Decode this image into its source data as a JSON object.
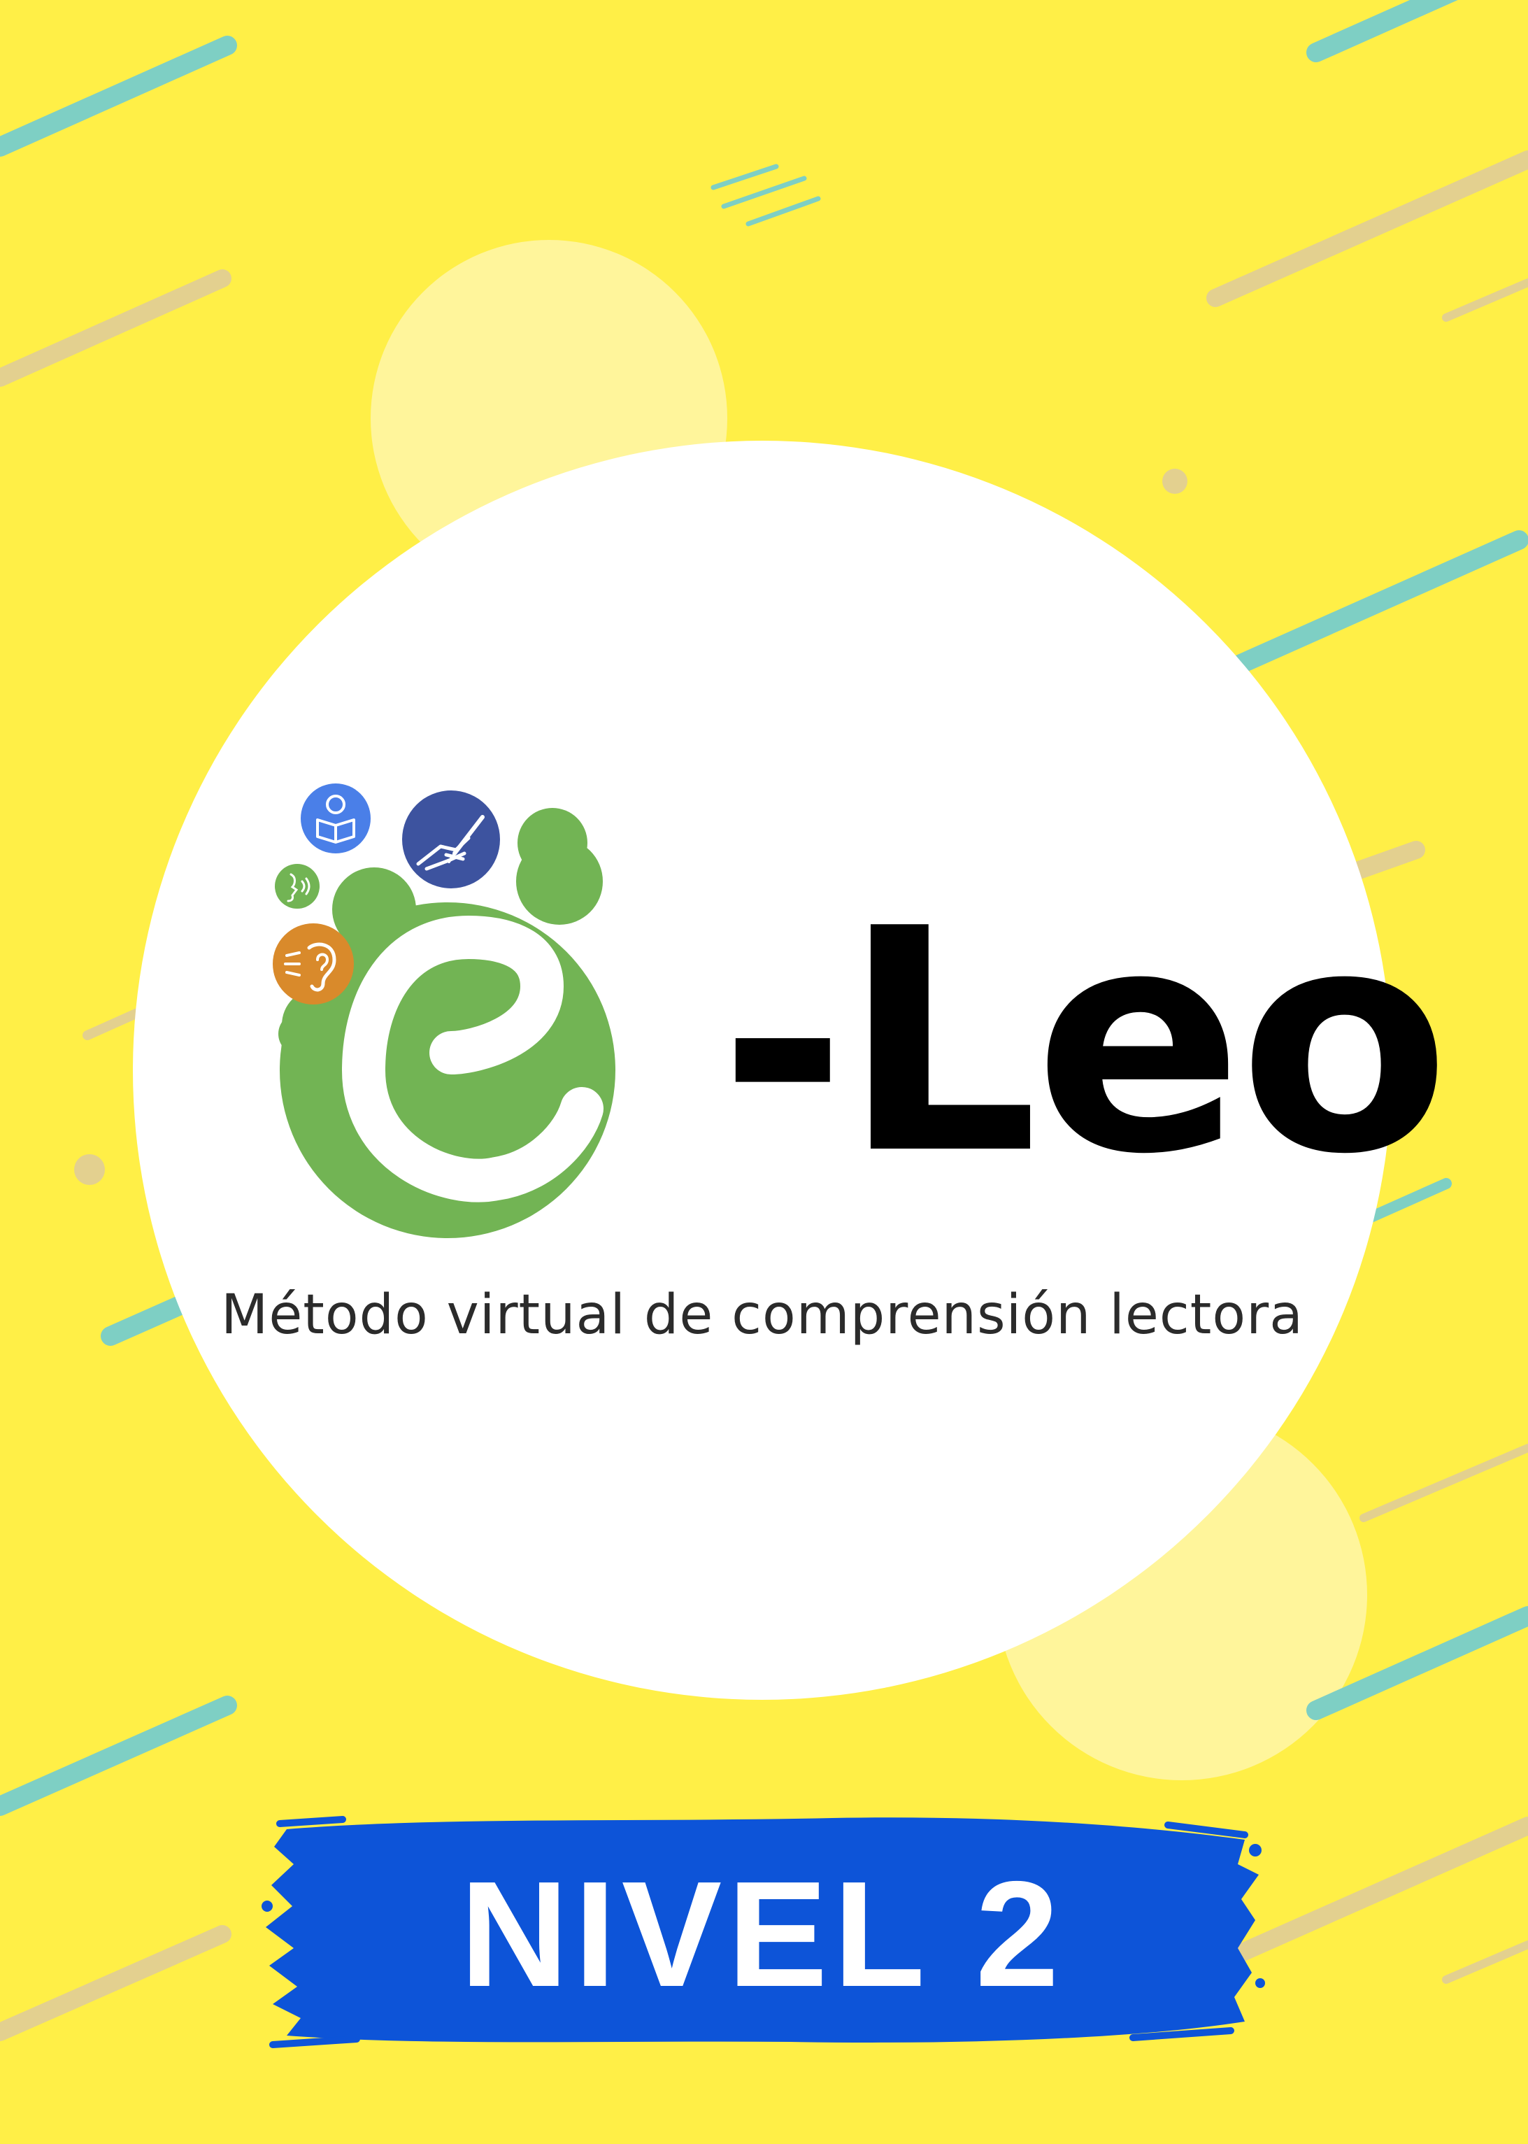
{
  "cover": {
    "logo_suffix": "-Leo",
    "subtitle": "Método virtual de comprensión lectora",
    "level_label": "NIVEL 2"
  },
  "icons": [
    "reading-person-icon",
    "hand-writing-icon",
    "speaking-face-icon",
    "listening-ear-icon"
  ],
  "colors": {
    "background": "#FFEF47",
    "accent_teal": "#7ECFC4",
    "accent_tan": "#E3D08F",
    "logo_green": "#72B454",
    "brush_blue": "#0D54D8",
    "icon_blue": "#4A7FE8",
    "icon_navy": "#3D539F",
    "icon_orange": "#D98A2B"
  }
}
